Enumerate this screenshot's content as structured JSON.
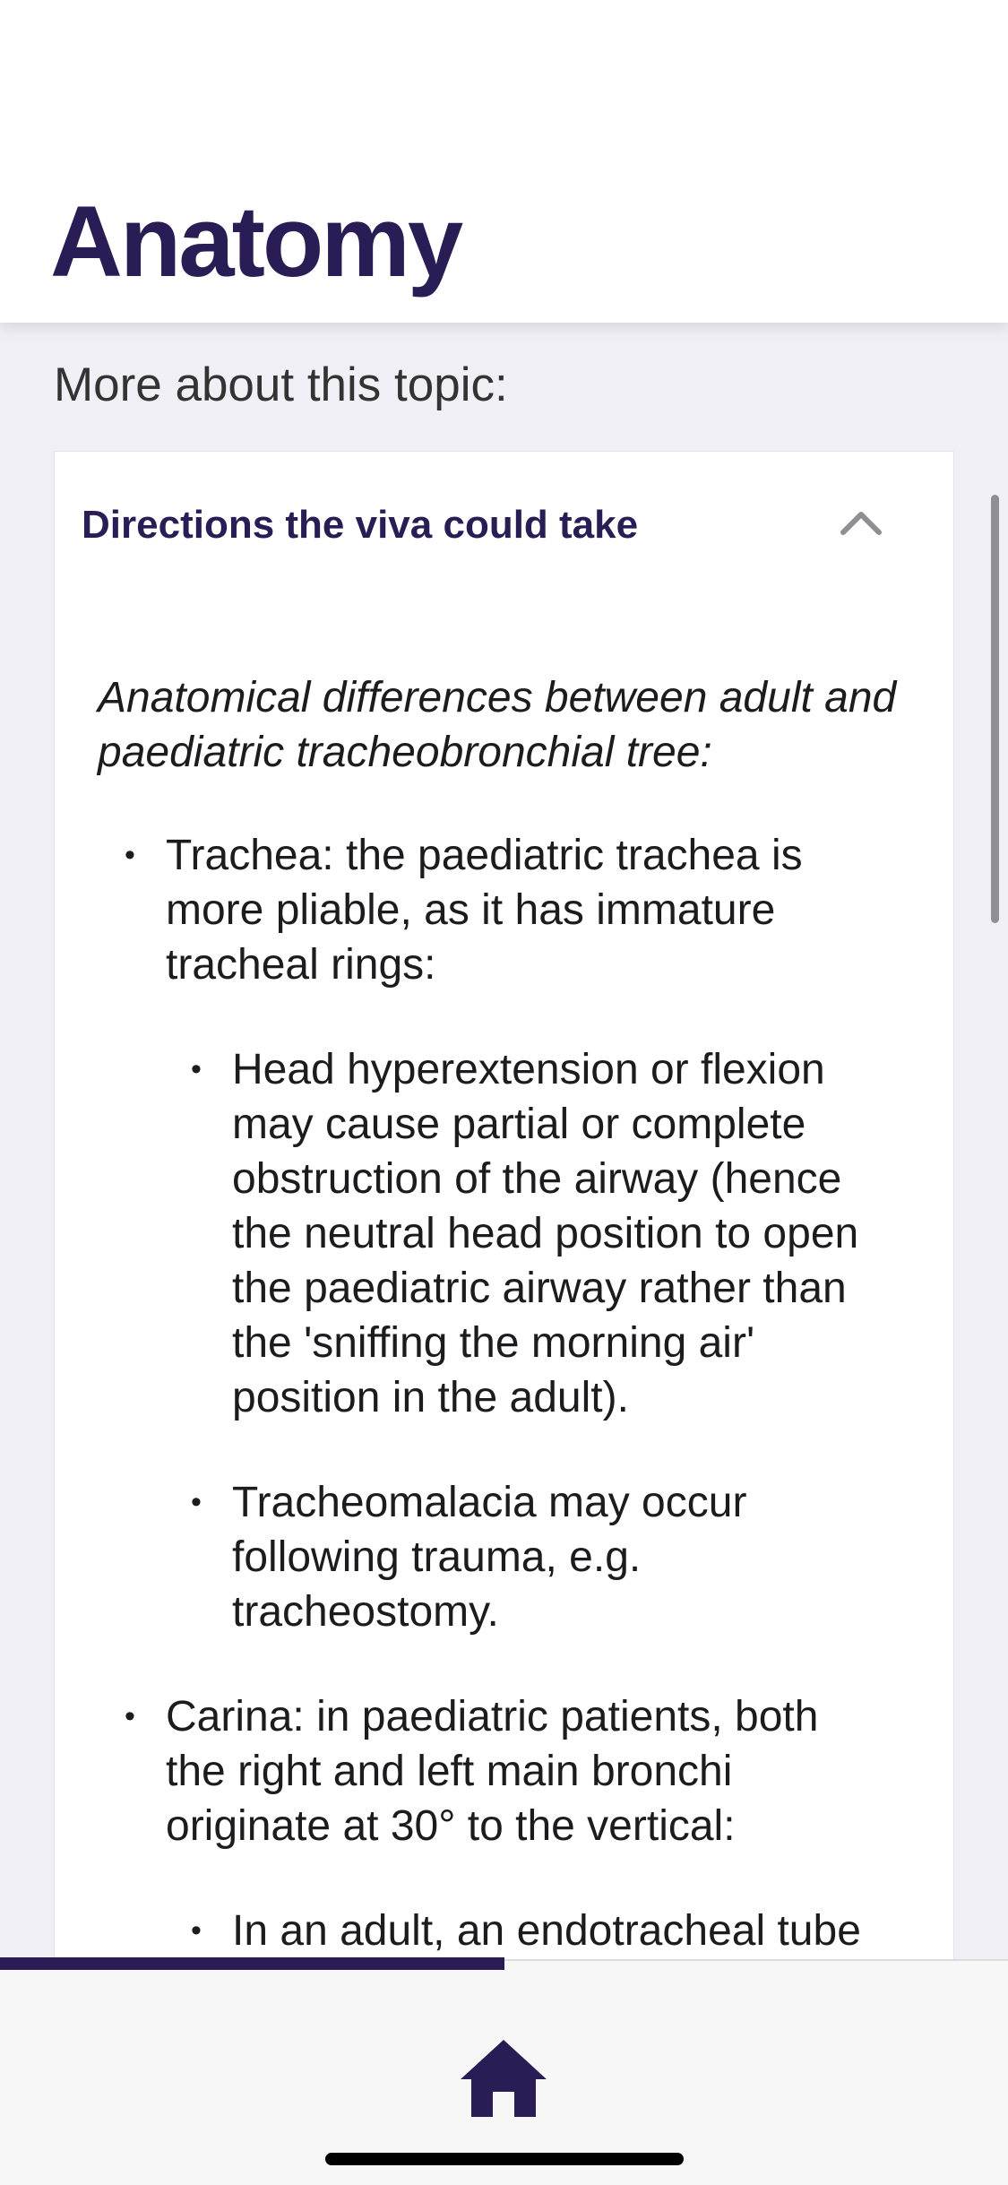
{
  "header": {
    "title": "Anatomy"
  },
  "section_label": "More about this topic:",
  "accordion": {
    "title": "Directions the viva could take",
    "expanded": true,
    "intro": "Anatomical differences between adult and paediatric tracheobronchial tree:",
    "items": [
      {
        "text": "Trachea: the paediatric trachea is more pliable, as it has immature tracheal rings:",
        "subitems": [
          "Head hyperextension or flexion may cause partial or complete obstruction of the airway (hence the neutral head position to open the paediatric airway rather than the 'sniffing the morning air' position in the adult).",
          "Tracheomalacia may occur following trauma, e.g. tracheostomy."
        ]
      },
      {
        "text": "Carina: in paediatric patients, both the right and left main bronchi originate at 30° to the vertical:",
        "subitems": [
          "In an adult, an endotracheal tube"
        ]
      }
    ]
  },
  "bottom_bar": {
    "progress": 0.5,
    "home_icon": "home-icon"
  },
  "colors": {
    "brand": "#2a1d55",
    "background": "#f0eff5",
    "card": "#ffffff",
    "chevron": "#8e8e93"
  }
}
